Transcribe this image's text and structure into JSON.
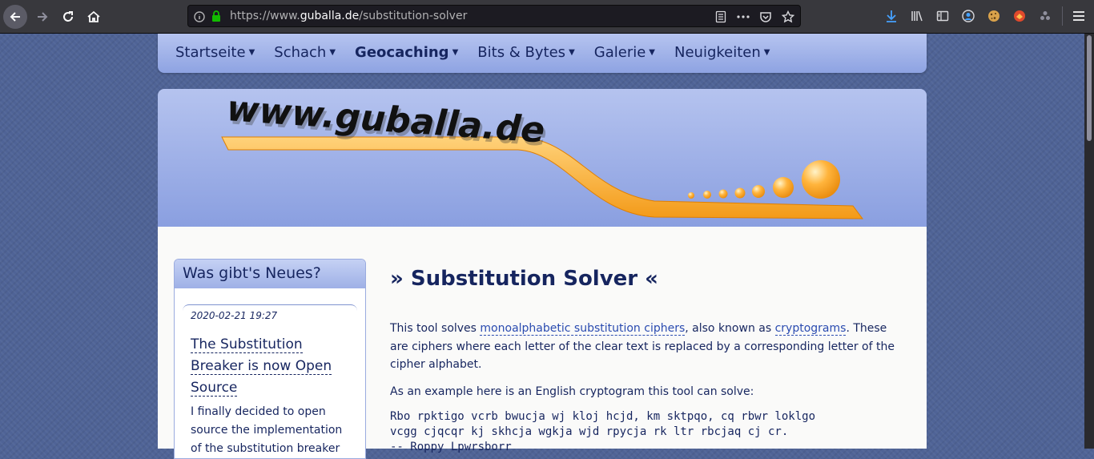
{
  "browser": {
    "url_scheme_prefix": "https://www.",
    "url_domain": "guballa.de",
    "url_path": "/substitution-solver"
  },
  "topnav": {
    "items": [
      {
        "label": "Startseite"
      },
      {
        "label": "Schach"
      },
      {
        "label": "Geocaching"
      },
      {
        "label": "Bits & Bytes"
      },
      {
        "label": "Galerie"
      },
      {
        "label": "Neuigkeiten"
      }
    ],
    "active": "Geocaching"
  },
  "header": {
    "logo_text": "www.guballa.de"
  },
  "sidebar": {
    "title": "Was gibt's Neues?",
    "news": {
      "date": "2020-02-21 19:27",
      "title": "The Substitution Breaker is now Open Source",
      "text": "I finally decided to open source the implementation of the substitution breaker"
    }
  },
  "main": {
    "heading": "» Substitution Solver «",
    "intro_1": "This tool solves ",
    "intro_link_1": "monoalphabetic substitution ciphers",
    "intro_2": ", also known as ",
    "intro_link_2": "cryptograms",
    "intro_3": ". These are ciphers where each letter of the clear text is replaced by a corresponding letter of the cipher alphabet.",
    "example_intro": "As an example here is an English cryptogram this tool can solve:",
    "cryptogram_line_1": "Rbo rpktigo vcrb bwucja wj kloj hcjd, km sktpqo, cq rbwr loklgo",
    "cryptogram_line_2": "vcgg cjqcqr kj skhcja wgkja wjd rpycja rk ltr rbcjaq cj cr.",
    "cryptogram_line_3": "-- Roppy Lpwrsborr"
  },
  "colors": {
    "page_bg": "#4f6396",
    "nav_text": "#16255f",
    "link": "#2a4bb0",
    "logo_swoosh": "#ffa726"
  }
}
